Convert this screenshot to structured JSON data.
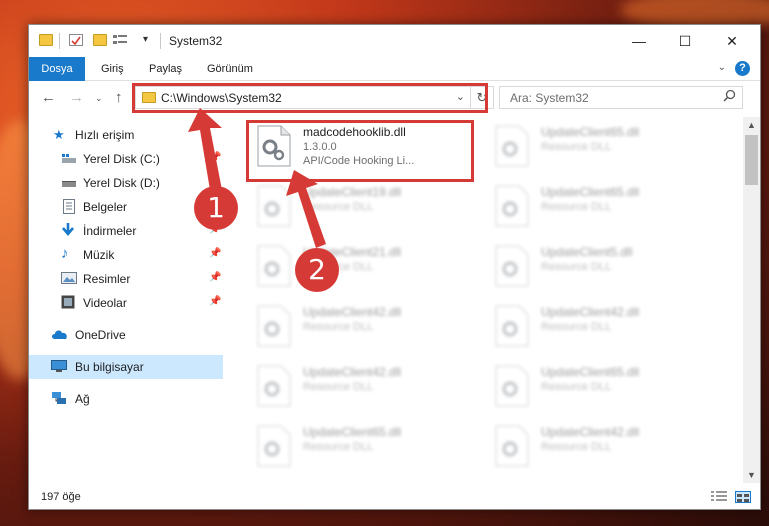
{
  "window": {
    "title": "System32",
    "minimize_label": "—",
    "maximize_label": "☐",
    "close_label": "✕"
  },
  "ribbon": {
    "tabs": [
      {
        "label": "Dosya"
      },
      {
        "label": "Giriş"
      },
      {
        "label": "Paylaş"
      },
      {
        "label": "Görünüm"
      }
    ],
    "help_label": "?"
  },
  "address": {
    "path": "C:\\Windows\\System32",
    "search_placeholder": "Ara: System32"
  },
  "sidebar": {
    "items": [
      {
        "label": "Hızlı erişim",
        "icon": "star-icon"
      },
      {
        "label": "Yerel Disk (C:)",
        "icon": "drive-c-icon"
      },
      {
        "label": "Yerel Disk (D:)",
        "icon": "drive-d-icon"
      },
      {
        "label": "Belgeler",
        "icon": "documents-icon"
      },
      {
        "label": "İndirmeler",
        "icon": "download-icon"
      },
      {
        "label": "Müzik",
        "icon": "music-icon"
      },
      {
        "label": "Resimler",
        "icon": "pictures-icon"
      },
      {
        "label": "Videolar",
        "icon": "video-icon"
      },
      {
        "label": "OneDrive",
        "icon": "cloud-icon"
      },
      {
        "label": "Bu bilgisayar",
        "icon": "computer-icon"
      },
      {
        "label": "Ağ",
        "icon": "network-icon"
      }
    ]
  },
  "files": {
    "highlighted": {
      "name": "madcodehooklib.dll",
      "version": "1.3.0.0",
      "description": "API/Code Hooking Li..."
    },
    "left": [
      {
        "name": "UpdateClient19.dll",
        "type": "Resource DLL"
      },
      {
        "name": "UpdateClient21.dll",
        "type": "Resource DLL"
      },
      {
        "name": "UpdateClient42.dll",
        "type": "Resource DLL"
      },
      {
        "name": "UpdateClient42.dll",
        "type": "Resource DLL"
      },
      {
        "name": "UpdateClient65.dll",
        "type": "Resource DLL"
      }
    ],
    "right": [
      {
        "name": "UpdateClient65.dll",
        "type": "Resource DLL"
      },
      {
        "name": "UpdateClient65.dll",
        "type": "Resource DLL"
      },
      {
        "name": "UpdateClient5.dll",
        "type": "Resource DLL"
      },
      {
        "name": "UpdateClient42.dll",
        "type": "Resource DLL"
      },
      {
        "name": "UpdateClient65.dll",
        "type": "Resource DLL"
      },
      {
        "name": "UpdateClient42.dll",
        "type": "Resource DLL"
      }
    ]
  },
  "status": {
    "count": "197 öğe"
  },
  "callouts": {
    "one": "1",
    "two": "2"
  },
  "colors": {
    "accent": "#1979ca",
    "callout": "#d63a36",
    "selection": "#cce8ff"
  }
}
